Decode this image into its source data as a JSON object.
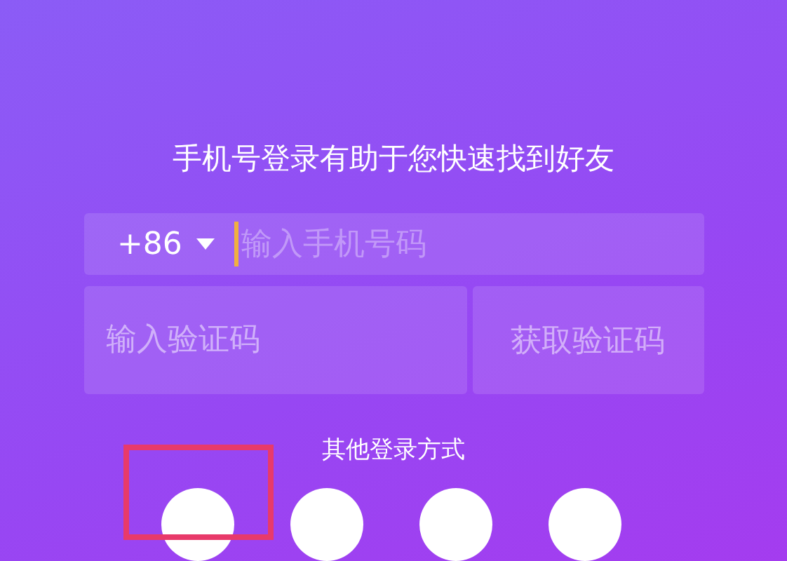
{
  "title": "手机号登录有助于您快速找到好友",
  "phone": {
    "country_code": "+86",
    "placeholder": "输入手机号码"
  },
  "code": {
    "placeholder": "输入验证码",
    "button": "获取验证码"
  },
  "other_login": {
    "label": "其他登录方式",
    "options": [
      {
        "highlighted": true
      },
      {
        "highlighted": false
      },
      {
        "highlighted": false
      },
      {
        "highlighted": false
      }
    ]
  }
}
